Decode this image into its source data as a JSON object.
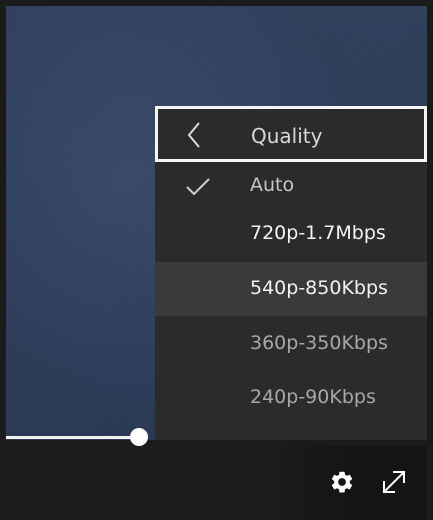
{
  "quality_menu": {
    "title": "Quality",
    "back_icon": "chevron-left-icon",
    "selected_icon": "check-icon",
    "items": [
      {
        "label": "Auto",
        "checked": true,
        "state": "selected"
      },
      {
        "label": "720p-1.7Mbps",
        "checked": false,
        "state": "normal"
      },
      {
        "label": "540p-850Kbps",
        "checked": false,
        "state": "hovered"
      },
      {
        "label": "360p-350Kbps",
        "checked": false,
        "state": "dimmed"
      },
      {
        "label": "240p-90Kbps",
        "checked": false,
        "state": "dimmed"
      }
    ]
  },
  "controls": {
    "settings_icon": "gear-icon",
    "fullscreen_icon": "fullscreen-expand-icon"
  },
  "colors": {
    "video_background": "#2e3e5b",
    "menu_background": "#2b2b2b",
    "menu_hover": "#3a3a3a",
    "focus_outline": "#f5f5f5",
    "control_bar": "#1d1d1d"
  }
}
